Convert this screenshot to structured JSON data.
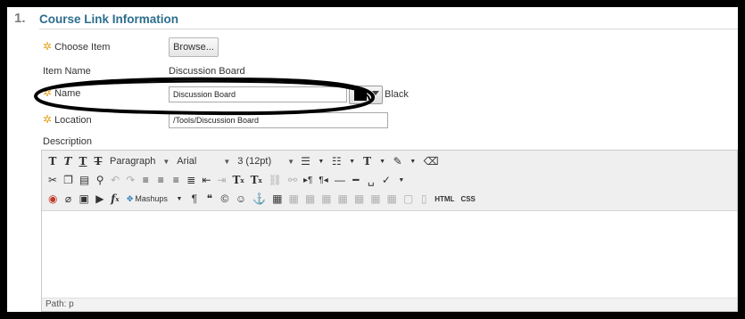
{
  "section": {
    "number": "1.",
    "title": "Course Link Information"
  },
  "form": {
    "required_marker": "✲",
    "choose_item": {
      "label": "Choose Item",
      "button": "Browse..."
    },
    "item_name": {
      "label": "Item Name",
      "value": "Discussion Board"
    },
    "name": {
      "label": "Name",
      "value": "Discussion Board",
      "color_name": "Black",
      "color_value": "#000000"
    },
    "location": {
      "label": "Location",
      "value": "/Tools/Discussion Board"
    },
    "description": {
      "label": "Description"
    }
  },
  "editor": {
    "format_dropdown": "Paragraph",
    "font_dropdown": "Arial",
    "size_dropdown": "3 (12pt)",
    "mashups_label": "Mashups",
    "html_label": "HTML",
    "css_label": "CSS",
    "path": "Path: p",
    "icons": {
      "row1": [
        "bold-icon",
        "italic-icon",
        "underline-icon",
        "strikethrough-icon",
        "bullet-list-icon",
        "numbered-list-icon",
        "text-color-icon",
        "highlight-icon",
        "eraser-icon"
      ],
      "row2": [
        "cut-icon",
        "copy-icon",
        "paste-icon",
        "find-icon",
        "undo-icon",
        "redo-icon",
        "align-left-icon",
        "align-center-icon",
        "align-right-icon",
        "justify-icon",
        "outdent-icon",
        "indent-icon",
        "superscript-icon",
        "subscript-icon",
        "link-icon",
        "unlink-icon",
        "ltr-icon",
        "rtl-icon",
        "horizontal-rule-icon",
        "hr-line-icon",
        "nonbreaking-space-icon",
        "spellcheck-icon"
      ],
      "row3": [
        "record-icon",
        "attach-icon",
        "image-icon",
        "media-icon",
        "formula-icon",
        "paragraph-mark-icon",
        "quote-icon",
        "copyright-icon",
        "emoticon-icon",
        "anchor-icon",
        "table-icon",
        "table-row-icon",
        "table-cell-icon",
        "table-props-icon",
        "insert-row-icon",
        "delete-row-icon",
        "insert-col-icon",
        "delete-col-icon",
        "merge-icon",
        "split-icon"
      ]
    }
  },
  "annotation": {
    "shape": "hand-drawn-ellipse",
    "color": "#000000"
  }
}
